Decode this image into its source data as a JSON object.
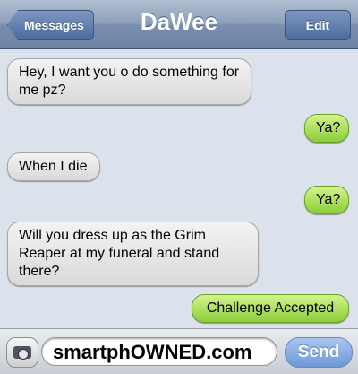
{
  "nav": {
    "back_label": "Messages",
    "title": "DaWee",
    "edit_label": "Edit"
  },
  "messages": [
    {
      "direction": "incoming",
      "text": "Hey, I want you o do something for me pz?"
    },
    {
      "direction": "outgoing",
      "text": "Ya?"
    },
    {
      "direction": "incoming",
      "text": "When I die"
    },
    {
      "direction": "outgoing",
      "text": "Ya?"
    },
    {
      "direction": "incoming",
      "text": "Will you dress up as the Grim Reaper at my funeral and stand there?"
    },
    {
      "direction": "outgoing",
      "text": "Challenge Accepted"
    }
  ],
  "compose": {
    "camera_icon": "camera-icon",
    "input_value": "smartphOWNED.com",
    "send_label": "Send"
  },
  "colors": {
    "incoming_bubble": "#e6e6e6",
    "outgoing_bubble": "#a9dc5a",
    "nav_bar": "#8d9fbb",
    "background": "#dbe2ec"
  }
}
